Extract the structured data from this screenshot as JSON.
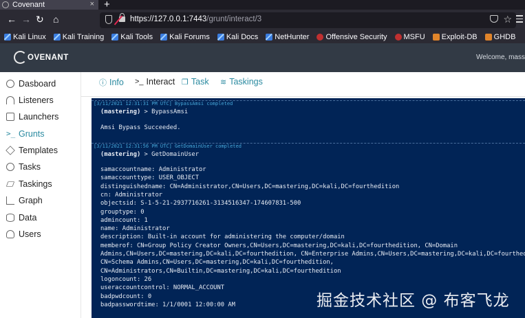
{
  "browser": {
    "tab_title": "Covenant",
    "tab_close": "×",
    "new_tab": "+",
    "back": "←",
    "forward": "→",
    "reload": "↻",
    "url_host": "https://127.0.0.1:7443",
    "url_path": "/grunt/interact/3",
    "star": "☆",
    "bookmarks": [
      {
        "label": "Kali Linux",
        "icon": "kali-dragon-icon"
      },
      {
        "label": "Kali Training",
        "icon": "kali-dragon-icon"
      },
      {
        "label": "Kali Tools",
        "icon": "kali-dragon-icon"
      },
      {
        "label": "Kali Forums",
        "icon": "kali-dragon-icon"
      },
      {
        "label": "Kali Docs",
        "icon": "kali-dragon-icon"
      },
      {
        "label": "NetHunter",
        "icon": "kali-dragon-icon"
      },
      {
        "label": "Offensive Security",
        "icon": "offsec-icon"
      },
      {
        "label": "MSFU",
        "icon": "offsec-icon"
      },
      {
        "label": "Exploit-DB",
        "icon": "exploit-db-icon"
      },
      {
        "label": "GHDB",
        "icon": "exploit-db-icon"
      }
    ]
  },
  "app": {
    "logo_text": "OVENANT",
    "welcome": "Welcome, mass"
  },
  "sidebar": {
    "items": [
      {
        "label": "Dasboard",
        "icon": "dashboard-icon"
      },
      {
        "label": "Listeners",
        "icon": "headphones-icon"
      },
      {
        "label": "Launchers",
        "icon": "rocket-icon"
      },
      {
        "label": "Grunts",
        "icon": "terminal-icon",
        "active": true
      },
      {
        "label": "Templates",
        "icon": "cube-icon"
      },
      {
        "label": "Tasks",
        "icon": "bolt-icon"
      },
      {
        "label": "Taskings",
        "icon": "layers-icon"
      },
      {
        "label": "Graph",
        "icon": "graph-icon"
      },
      {
        "label": "Data",
        "icon": "database-icon"
      },
      {
        "label": "Users",
        "icon": "user-icon"
      }
    ]
  },
  "tabs": [
    {
      "label": "Info",
      "icon": "ⓘ"
    },
    {
      "label": "Interact",
      "icon": ">_",
      "active": true
    },
    {
      "label": "Task",
      "icon": "❒"
    },
    {
      "label": "Taskings",
      "icon": "≋"
    }
  ],
  "terminal": {
    "block1": {
      "header": "[3/11/2021 12:31:31 PM UTC] BypassAmsi completed",
      "prompt": "(mastering)",
      "command": " > BypassAmsi",
      "output": [
        "Amsi Bypass Succeeded."
      ]
    },
    "block2": {
      "header": "[3/11/2021 12:31:56 PM UTC] GetDomainUser completed",
      "prompt": "(mastering)",
      "command": " > GetDomainUser",
      "output": [
        "samaccountname: Administrator",
        "samaccounttype: USER_OBJECT",
        "distinguishedname: CN=Administrator,CN=Users,DC=mastering,DC=kali,DC=fourthedition",
        "cn: Administrator",
        "objectsid: S-1-5-21-2937716261-3134516347-174607831-500",
        "grouptype: 0",
        "admincount: 1",
        "name: Administrator",
        "description: Built-in account for administering the computer/domain",
        "memberof: CN=Group Policy Creator Owners,CN=Users,DC=mastering,DC=kali,DC=fourthedition, CN=Domain",
        "Admins,CN=Users,DC=mastering,DC=kali,DC=fourthedition, CN=Enterprise Admins,CN=Users,DC=mastering,DC=kali,DC=fourthedition,",
        "CN=Schema Admins,CN=Users,DC=mastering,DC=kali,DC=fourthedition,",
        "CN=Administrators,CN=Builtin,DC=mastering,DC=kali,DC=fourthedition",
        "logoncount: 26",
        "useraccountcontrol: NORMAL_ACCOUNT",
        "badpwdcount: 0",
        "badpasswordtime: 1/1/0001 12:00:00 AM"
      ]
    }
  },
  "watermark": "掘金技术社区 @ 布客飞龙",
  "colors": {
    "header_bg": "#323a45",
    "terminal_bg": "#012456",
    "accent": "#2a8aa0"
  }
}
